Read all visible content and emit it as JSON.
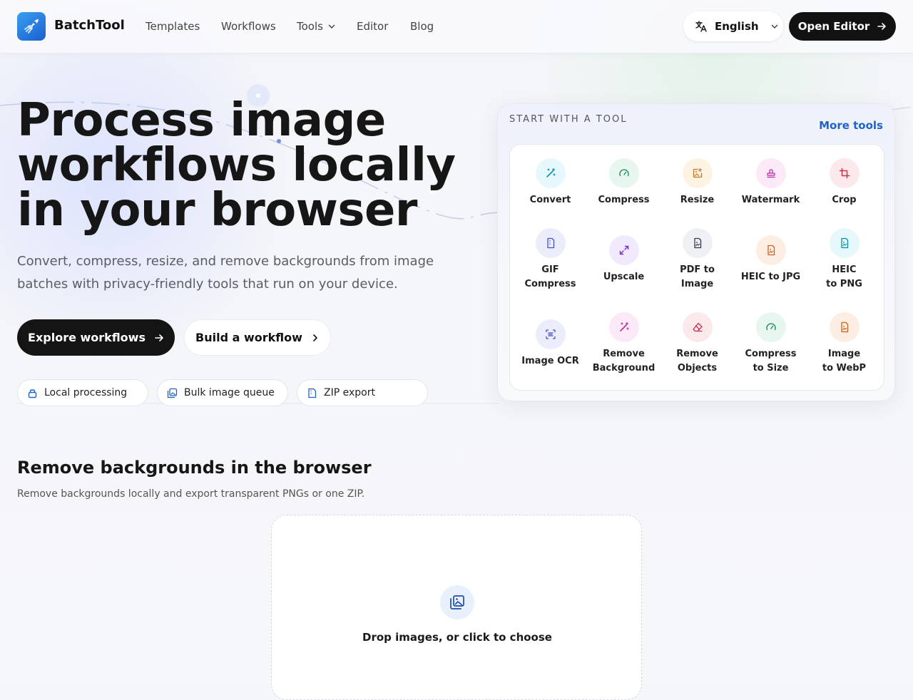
{
  "header": {
    "brand": "BatchTool",
    "nav": [
      {
        "label": "Templates",
        "icon": null
      },
      {
        "label": "Workflows",
        "icon": null
      },
      {
        "label": "Tools",
        "icon": "chevron-down-icon"
      },
      {
        "label": "Editor",
        "icon": null
      },
      {
        "label": "Blog",
        "icon": null
      }
    ],
    "language": "English",
    "open_editor": "Open Editor"
  },
  "hero": {
    "title_line1": "Process image",
    "title_line2": "workflows locally",
    "title_line3": "in your browser",
    "subtitle": "Convert, compress, resize, and remove backgrounds from image batches with privacy-friendly tools that run on your device.",
    "primary_button": "Explore workflows",
    "secondary_button": "Build a workflow",
    "chips": [
      {
        "label": "Local processing",
        "icon": "lock-icon"
      },
      {
        "label": "Bulk image queue",
        "icon": "image-stack-icon"
      },
      {
        "label": "ZIP export",
        "icon": "zip-file-icon"
      }
    ]
  },
  "tools_panel": {
    "label": "START WITH A TOOL",
    "more": "More tools",
    "tools": [
      {
        "line1": "Convert",
        "line2": "",
        "icon": "magic-wand-icon",
        "color": "#0b8fa8",
        "bg": "#e6f8fb"
      },
      {
        "line1": "Compress",
        "line2": "",
        "icon": "gauge-icon",
        "color": "#1a8f5e",
        "bg": "#e7f7ef"
      },
      {
        "line1": "Resize",
        "line2": "",
        "icon": "image-plus-icon",
        "color": "#c9731a",
        "bg": "#fdf3e3"
      },
      {
        "line1": "Watermark",
        "line2": "",
        "icon": "stamp-icon",
        "color": "#b72aa8",
        "bg": "#fbe9f7"
      },
      {
        "line1": "Crop",
        "line2": "",
        "icon": "crop-icon",
        "color": "#c8324a",
        "bg": "#fce9ec"
      },
      {
        "line1": "GIF",
        "line2": "Compress",
        "icon": "file-gif-icon",
        "color": "#4650c8",
        "bg": "#ebedfb"
      },
      {
        "line1": "Upscale",
        "line2": "",
        "icon": "expand-icon",
        "color": "#7a2fd0",
        "bg": "#f1e9fc"
      },
      {
        "line1": "PDF to",
        "line2": "Image",
        "icon": "file-image-icon",
        "color": "#333a48",
        "bg": "#eef0f4"
      },
      {
        "line1": "HEIC to JPG",
        "line2": "",
        "icon": "file-image-orange-icon",
        "color": "#d0601a",
        "bg": "#fdeee3"
      },
      {
        "line1": "HEIC",
        "line2": "to PNG",
        "icon": "file-image-teal-icon",
        "color": "#0b8fa8",
        "bg": "#e6f8fb"
      },
      {
        "line1": "Image OCR",
        "line2": "",
        "icon": "scan-text-icon",
        "color": "#4650c8",
        "bg": "#ebedfb"
      },
      {
        "line1": "Remove",
        "line2": "Background",
        "icon": "magic-wand-purple-icon",
        "color": "#b72aa8",
        "bg": "#fbe9f7"
      },
      {
        "line1": "Remove",
        "line2": "Objects",
        "icon": "eraser-icon",
        "color": "#c8324a",
        "bg": "#fce9ec"
      },
      {
        "line1": "Compress",
        "line2": "to Size",
        "icon": "gauge-green-icon",
        "color": "#1a8f5e",
        "bg": "#e7f7ef"
      },
      {
        "line1": "Image",
        "line2": "to WebP",
        "icon": "file-image-amber-icon",
        "color": "#d0601a",
        "bg": "#fdeee3"
      }
    ]
  },
  "section": {
    "title": "Remove backgrounds in the browser",
    "subtitle": "Remove backgrounds locally and export transparent PNGs or one ZIP.",
    "drop_text": "Drop images, or click to choose"
  }
}
